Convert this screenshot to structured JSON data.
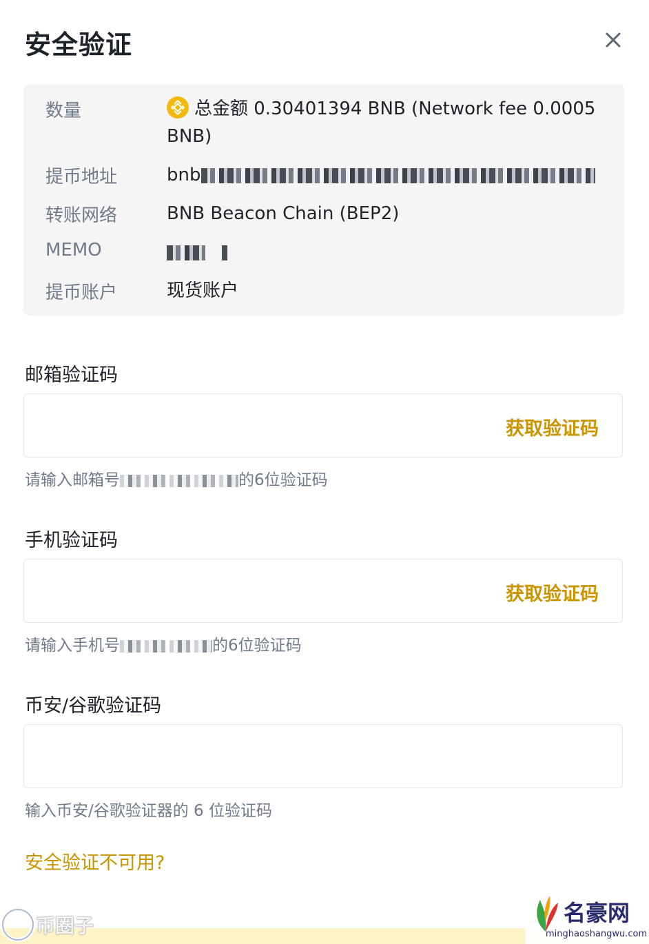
{
  "dialog": {
    "title": "安全验证"
  },
  "summary": {
    "amount_label": "数量",
    "amount_value_line1": "总金额 0.30401394 BNB (Network fee 0.0005",
    "amount_value_line2": "BNB)",
    "address_label": "提币地址",
    "address_prefix": "bnb",
    "network_label": "转账网络",
    "network_value": "BNB Beacon Chain (BEP2)",
    "memo_label": "MEMO",
    "account_label": "提币账户",
    "account_value": "现货账户"
  },
  "email_code": {
    "label": "邮箱验证码",
    "action": "获取验证码",
    "hint_prefix": "请输入邮箱号",
    "hint_suffix": "的6位验证码"
  },
  "phone_code": {
    "label": "手机验证码",
    "action": "获取验证码",
    "hint_prefix": "请输入手机号",
    "hint_suffix": "的6位验证码"
  },
  "authenticator_code": {
    "label": "币安/谷歌验证码",
    "hint": "输入币安/谷歌验证器的 6 位验证码"
  },
  "unavailable_link": "安全验证不可用?",
  "watermarks": {
    "left": "币圈子",
    "right": "名豪网",
    "right_sub": "minghaoshangwu.com"
  },
  "colors": {
    "accent": "#c99400",
    "bnb": "#f0b90b",
    "muted": "#707a8a",
    "panel": "#f5f5f5"
  },
  "icons": [
    "close-icon",
    "bnb-coin-icon"
  ]
}
